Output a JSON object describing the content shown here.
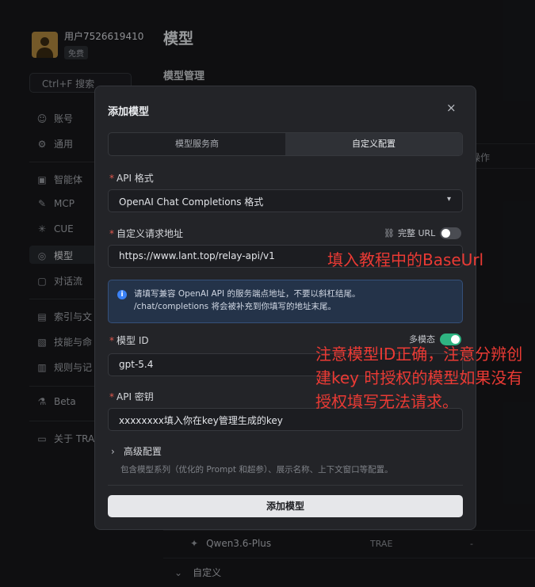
{
  "sidebar": {
    "user_name": "用户7526619410",
    "user_plan": "免费",
    "search_placeholder": "Ctrl+F 搜索",
    "items": [
      {
        "label": "账号",
        "icon": "user-icon"
      },
      {
        "label": "通用",
        "icon": "gear-icon"
      },
      {
        "label": "智能体",
        "icon": "agent-icon"
      },
      {
        "label": "MCP",
        "icon": "wrench-icon"
      },
      {
        "label": "CUE",
        "icon": "sparkle-icon"
      },
      {
        "label": "模型",
        "icon": "globe-icon"
      },
      {
        "label": "对话流",
        "icon": "chat-icon"
      },
      {
        "label": "索引与文",
        "icon": "index-icon"
      },
      {
        "label": "技能与命",
        "icon": "skill-icon"
      },
      {
        "label": "规则与记",
        "icon": "rules-icon"
      },
      {
        "label": "Beta",
        "icon": "flask-icon"
      },
      {
        "label": "关于 TRA",
        "icon": "about-icon"
      }
    ]
  },
  "main": {
    "title": "模型",
    "subtitle": "模型管理",
    "col_operation": "操作",
    "row_name": "Qwen3.6-Plus",
    "row_source": "TRAE",
    "row_op": "-",
    "custom_section": "自定义"
  },
  "modal": {
    "title": "添加模型",
    "close": "×",
    "tabs": [
      "模型服务商",
      "自定义配置"
    ],
    "api_format_label": "API 格式",
    "api_format_value": "OpenAI Chat Completions 格式",
    "url_label": "自定义请求地址",
    "full_url_label": "完整 URL",
    "full_url_on": false,
    "url_value": "https://www.lant.top/relay-api/v1",
    "info_line1": "请填写兼容 OpenAI API 的服务端点地址，不要以斜杠结尾。",
    "info_line2": "/chat/completions 将会被补充到你填写的地址末尾。",
    "model_id_label": "模型 ID",
    "multimodal_label": "多模态",
    "multimodal_on": true,
    "model_id_value": "gpt-5.4",
    "api_key_label": "API 密钥",
    "api_key_value": "xxxxxxxx填入你在key管理生成的key",
    "advanced_label": "高级配置",
    "advanced_desc": "包含模型系列（优化的 Prompt 和超参）、展示名称、上下文窗口等配置。",
    "submit_label": "添加模型",
    "required_mark": "*"
  },
  "annotations": {
    "baseurl_note": "填入教程中的BaseUrl",
    "model_note": "注意模型ID正确，注意分辨创建key 时授权的模型如果没有授权填写无法请求。"
  },
  "colors": {
    "accent_toggle": "#2fb482",
    "annotation": "#ea3a34",
    "required": "#e05a4f"
  }
}
